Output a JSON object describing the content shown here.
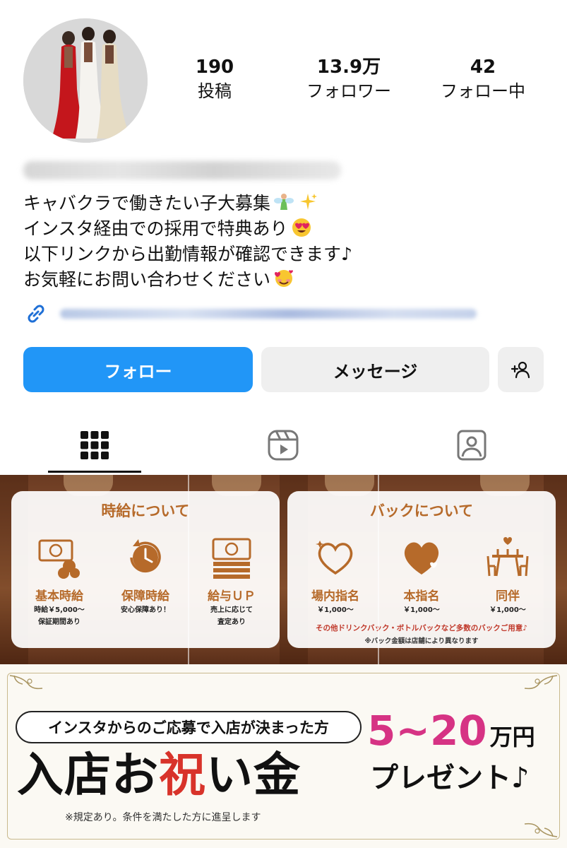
{
  "profile": {
    "stats": [
      {
        "value": "190",
        "label": "投稿"
      },
      {
        "value": "13.9万",
        "label": "フォロワー"
      },
      {
        "value": "42",
        "label": "フォロー中"
      }
    ],
    "bio": [
      "キャバクラで働きたい子大募集",
      "インスタ経由での採用で特典あり",
      "以下リンクから出勤情報が確認できます♪",
      "お気軽にお問い合わせください"
    ]
  },
  "buttons": {
    "follow": "フォロー",
    "message": "メッセージ"
  },
  "tabs": [
    "grid-icon",
    "reels-icon",
    "tagged-icon"
  ],
  "post1": {
    "hourly": {
      "title": "時給について",
      "items": [
        {
          "name": "基本時給",
          "sub1": "時給￥5,000〜",
          "sub2": "保証期間あり"
        },
        {
          "name": "保障時給",
          "sub1": "安心保障あり！",
          "sub2": ""
        },
        {
          "name": "給与ＵＰ",
          "sub1": "売上に応じて",
          "sub2": "査定あり"
        }
      ]
    },
    "back": {
      "title": "バックについて",
      "items": [
        {
          "name": "場内指名",
          "sub1": "￥1,000〜"
        },
        {
          "name": "本指名",
          "sub1": "￥1,000〜"
        },
        {
          "name": "同伴",
          "sub1": "￥1,000〜"
        }
      ],
      "note1": "その他ドリンクバック・ボトルバックなど多数のバックご用意♪",
      "note2": "※バック金額は店舗により異なります"
    }
  },
  "post2": {
    "tagline": "インスタからのご応募で入店が決まった方",
    "headline_pre": "入店お",
    "headline_red": "祝",
    "headline_post": "い金",
    "amount": "5~20",
    "unit": "万円",
    "present": "プレゼント♪",
    "disclaimer": "※規定あり。条件を満たした方に進呈します"
  },
  "colors": {
    "follow_button": "#2196f7",
    "accent_brown": "#b66a2a",
    "amount_pink": "#d63384",
    "headline_red": "#d8332a"
  }
}
